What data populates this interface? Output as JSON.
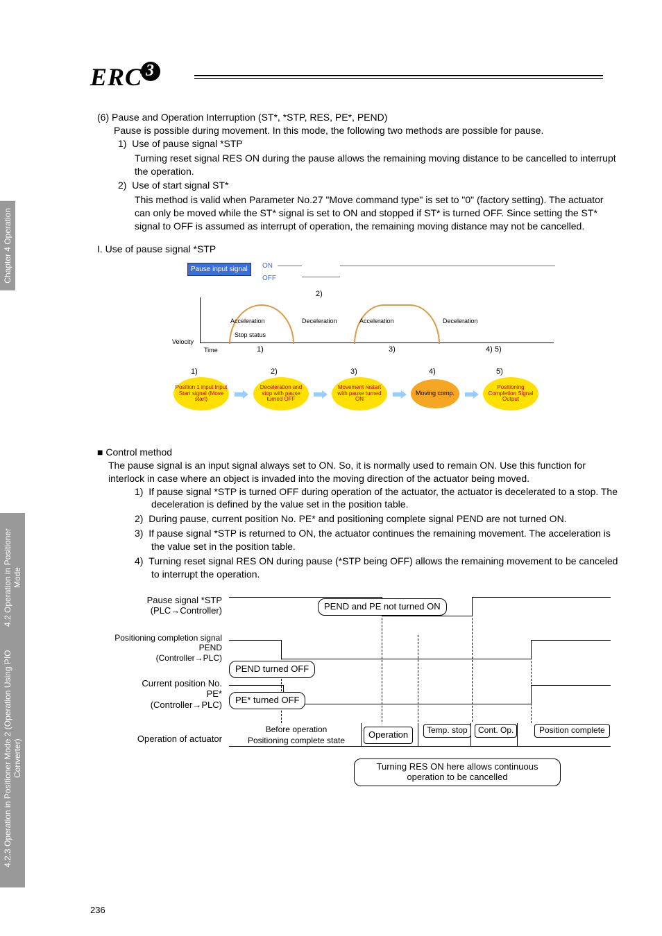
{
  "page_number": "236",
  "logo_text": "ERC",
  "side_tabs": {
    "tab1": "Chapter 4 Operation",
    "tab2_line1": "4.2 Operation in Positioner Mode",
    "tab2_line2": "4.2.3 Operation in Positioner Mode 2 (Operation Using PIO Converter)"
  },
  "section6": {
    "title": "(6) Pause and Operation Interruption (ST*, *STP, RES, PE*, PEND)",
    "intro": "Pause is possible during movement. In this mode, the following two methods are possible for pause.",
    "item1_num": "1)",
    "item1_head": "Use of pause signal *STP",
    "item1_body": "Turning reset signal RES ON during the pause allows the remaining moving distance to be cancelled to interrupt the operation.",
    "item2_num": "2)",
    "item2_head": "Use of start signal ST*",
    "item2_body": "This method is valid when Parameter No.27 \"Move command type\" is set to \"0\" (factory setting). The actuator can only be moved while the ST* signal is set to ON and stopped if ST* is turned OFF. Since setting the ST* signal to OFF is assumed as interrupt of operation, the remaining moving distance may not be cancelled."
  },
  "use_pause_heading": "I. Use of pause signal *STP",
  "diagram1": {
    "pause_badge": "Pause input signal",
    "on": "ON",
    "off": "OFF",
    "velocity": "Velocity",
    "time": "Time",
    "stop_status": "Stop status",
    "accel": "Acceleration",
    "decel": "Deceleration",
    "n1": "1)",
    "n2": "2)",
    "n3": "3)",
    "n4": "4) 5)",
    "f1": "1)",
    "f2": "2)",
    "f3": "3)",
    "f4": "4)",
    "f5": "5)",
    "oval1": "Position 1 input Input Start signal (Move start)",
    "oval2": "Deceleration and stop with pause turned OFF",
    "oval3": "Movement restart with pause turned ON",
    "oval4": "Moving comp.",
    "oval5": "Positioning Completion Signal Output"
  },
  "control_heading": "Control method",
  "control_intro": "The pause signal is an input signal always set to ON. So, it is normally used to remain ON. Use this function for interlock in case where an object is invaded into the moving direction of the actuator being moved.",
  "c1_num": "1)",
  "c1": "If pause signal *STP is turned OFF during operation of the actuator, the actuator is decelerated to a stop. The deceleration is defined by the value set in the position table.",
  "c2_num": "2)",
  "c2": "During pause, current position No. PE* and positioning complete signal PEND are not turned ON.",
  "c3_num": "3)",
  "c3": "If pause signal *STP is returned to ON, the actuator continues the remaining movement. The acceleration is the value set in the position table.",
  "c4_num": "4)",
  "c4": "Turning reset signal RES ON during pause (*STP being OFF) allows the remaining movement to be canceled to interrupt the operation.",
  "timing": {
    "row1_a": "Pause signal  *STP",
    "row1_b": "(PLC→Controller)",
    "row2_a": "Positioning completion signal",
    "row2_b": "PEND",
    "row2_c": "(Controller→PLC)",
    "row3_a": "Current position No.",
    "row3_b": "PE*",
    "row3_c": "(Controller→PLC)",
    "row4_a": "Operation of actuator",
    "box_pend_pe": "PEND and PE not turned ON",
    "box_pend_off": "PEND turned OFF",
    "box_pe_off": "PE* turned OFF",
    "op_before_a": "Before operation",
    "op_before_b": "Positioning complete state",
    "op_op": "Operation",
    "op_temp": "Temp. stop",
    "op_cont": "Cont. Op.",
    "op_pos": "Position complete",
    "res_note": "Turning RES ON here allows continuous operation to be cancelled"
  }
}
